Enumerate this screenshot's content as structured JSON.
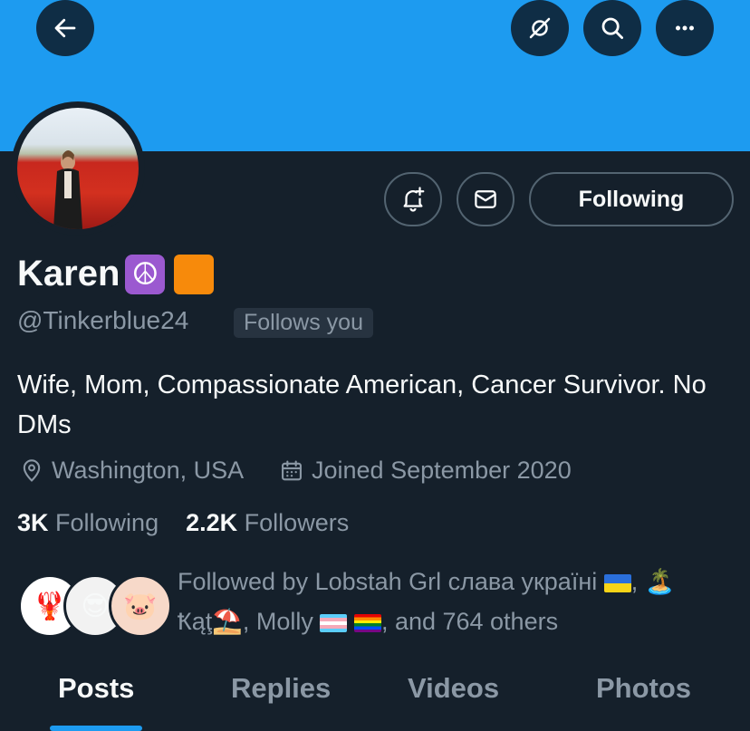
{
  "header": {
    "back_icon": "arrow-left-icon",
    "actions": [
      "eye-slash-icon",
      "search-icon",
      "more-icon"
    ]
  },
  "profile": {
    "name": "Karen",
    "name_emojis": [
      "☮️",
      "🟧"
    ],
    "handle": "@Tinkerblue24",
    "follows_you_badge": "Follows you",
    "bio": "Wife, Mom, Compassionate American, Cancer Survivor. No DMs",
    "location": "Washington, USA",
    "joined": "Joined September 2020",
    "following_count": "3K",
    "following_label": "Following",
    "followers_count": "2.2K",
    "followers_label": "Followers"
  },
  "buttons": {
    "notify_icon": "bell-plus-icon",
    "message_icon": "mail-icon",
    "following_label": "Following"
  },
  "followed_by": {
    "prefix": "Followed by Lobstah Grl слава україні",
    "second_name": "Ҟąţ",
    "third_name": "Molly",
    "suffix": ", and 764 others"
  },
  "tabs": [
    {
      "label": "Posts",
      "active": true
    },
    {
      "label": "Replies",
      "active": false
    },
    {
      "label": "Videos",
      "active": false
    },
    {
      "label": "Photos",
      "active": false
    }
  ],
  "colors": {
    "background": "#15202b",
    "banner": "#1d9bf0",
    "muted_text": "#8b98a5",
    "accent": "#1d9bf0"
  }
}
